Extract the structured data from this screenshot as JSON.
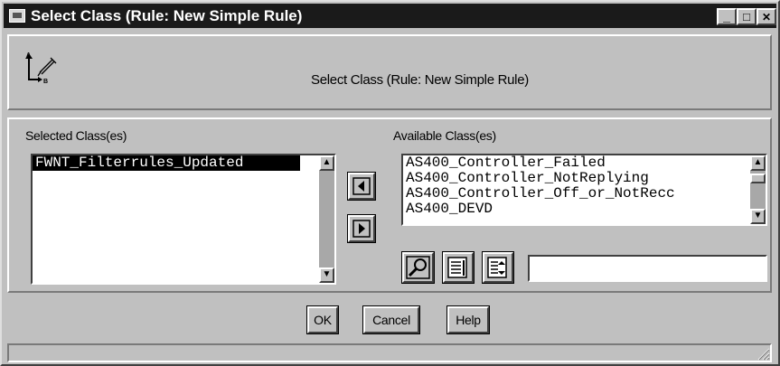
{
  "window": {
    "title": "Select Class (Rule: New Simple Rule)"
  },
  "titlebar_buttons": {
    "minimize": "_",
    "maximize": "□",
    "close": "✕"
  },
  "header": {
    "text": "Select Class (Rule: New Simple Rule)"
  },
  "selected": {
    "label": "Selected Class(es)",
    "items": [
      "FWNT_Filterrules_Updated"
    ]
  },
  "available": {
    "label": "Available Class(es)",
    "items": [
      "AS400_Controller_Failed",
      "AS400_Controller_NotReplying",
      "AS400_Controller_Off_or_NotRecc",
      "AS400_DEVD"
    ],
    "search_value": ""
  },
  "buttons": {
    "ok": "OK",
    "cancel": "Cancel",
    "help": "Help"
  },
  "icons": {
    "header": "class-hierarchy-icon",
    "move_left": "arrow-left-icon",
    "move_right": "arrow-right-icon",
    "search": "magnifier-icon",
    "list1": "list-icon",
    "list2": "list-detail-icon"
  },
  "colors": {
    "title_bg": "#1a1a1a",
    "face": "#c0c0c0",
    "selection": "#000000"
  }
}
